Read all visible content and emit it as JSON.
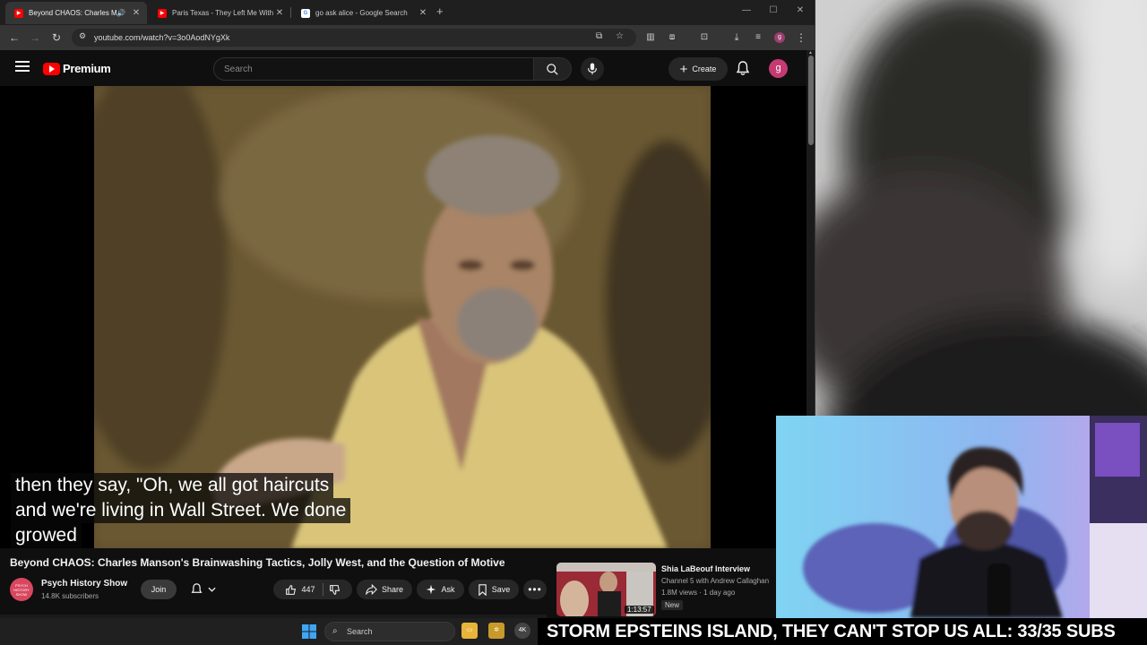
{
  "browser": {
    "tabs": [
      {
        "title": "Beyond CHAOS: Charles Ma",
        "active": true,
        "audio": true
      },
      {
        "title": "Paris Texas - They Left Me With",
        "active": false,
        "audio": false
      },
      {
        "title": "go ask alice - Google Search",
        "active": false,
        "audio": false
      }
    ],
    "url": "youtube.com/watch?v=3o0AodNYgXk",
    "profile_initial": "g"
  },
  "youtube": {
    "logo_text": "Premium",
    "search_placeholder": "Search",
    "create_label": "Create",
    "avatar_initial": "g"
  },
  "player": {
    "captions": [
      "then they say, \"Oh, we all got haircuts",
      "and we're living in Wall Street. We done",
      "growed"
    ]
  },
  "video": {
    "title": "Beyond CHAOS: Charles Manson's Brainwashing Tactics, Jolly West, and the Question of Motive",
    "channel_name": "Psych History Show",
    "channel_subs": "14.8K subscribers",
    "channel_avatar_text": "PSYCH HISTORY SHOW",
    "join_label": "Join",
    "like_count": "447",
    "share_label": "Share",
    "ask_label": "Ask",
    "save_label": "Save"
  },
  "recommendation": {
    "title": "Shia LaBeouf Interview",
    "channel": "Channel 5 with Andrew Callaghan",
    "meta": "1.8M views · 1 day ago",
    "badge": "New",
    "duration": "1:13:57"
  },
  "taskbar": {
    "search_label": "Search",
    "app_4k": "4K"
  },
  "ticker": {
    "text": "STORM EPSTEINS ISLAND, THEY CAN'T STOP US ALL: 33/35 SUBS"
  },
  "colors": {
    "brand_red": "#ff0000",
    "avatar_pink": "#c43b73",
    "page_bg": "#0f0f0f"
  }
}
